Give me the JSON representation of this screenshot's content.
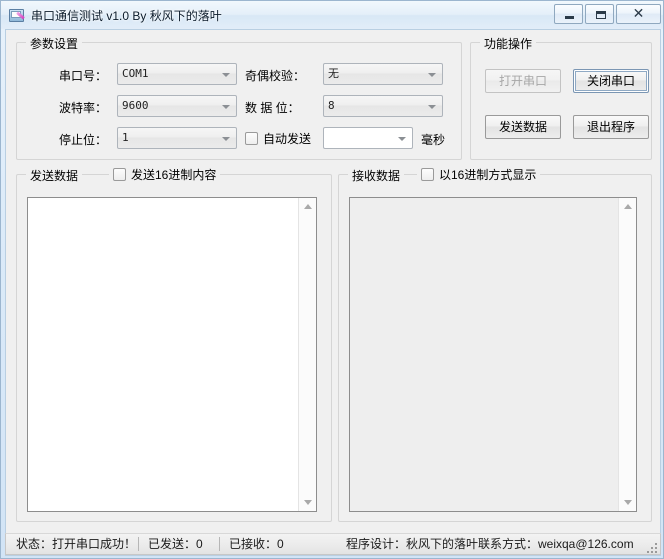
{
  "window": {
    "title": "串口通信测试 v1.0 By 秋风下的落叶",
    "icon": "serial-port-app-icon",
    "minimize_label": "",
    "maximize_label": "",
    "close_label": "✕"
  },
  "param_group": {
    "title": "参数设置",
    "fields": [
      {
        "label": "串口号：",
        "value": "COM1",
        "enabled": false
      },
      {
        "label": "波特率：",
        "value": "9600",
        "enabled": false
      },
      {
        "label": "停止位：",
        "value": "1",
        "enabled": false
      },
      {
        "label": "奇偶校验：",
        "value": "无",
        "enabled": false
      },
      {
        "label": "数 据 位：",
        "value": "8",
        "enabled": false
      }
    ],
    "auto_send": {
      "label": "自动发送",
      "checked": false,
      "interval_value": "",
      "unit_label": "毫秒"
    }
  },
  "function_group": {
    "title": "功能操作",
    "buttons": [
      {
        "label": "打开串口",
        "enabled": false,
        "focused": false
      },
      {
        "label": "关闭串口",
        "enabled": true,
        "focused": true
      },
      {
        "label": "发送数据",
        "enabled": true,
        "focused": false
      },
      {
        "label": "退出程序",
        "enabled": true,
        "focused": false
      }
    ]
  },
  "send_panel": {
    "title": "发送数据",
    "hex_checkbox_label": "发送16进制内容",
    "hex_checked": false,
    "text": ""
  },
  "receive_panel": {
    "title": "接收数据",
    "hex_checkbox_label": "以16进制方式显示",
    "hex_checked": false,
    "text": ""
  },
  "statusbar": {
    "state": "状态：打开串口成功！",
    "sent": "已发送：0",
    "received": "已接收：0",
    "author": "程序设计：秋风下的落叶",
    "contact": "联系方式：weixqa@126.com"
  },
  "colors": {
    "client_bg": "#f0f0f0",
    "frame": "#9cb6cf",
    "group_border": "#d5d5d5",
    "focus_ring": "#8fa9c4"
  }
}
